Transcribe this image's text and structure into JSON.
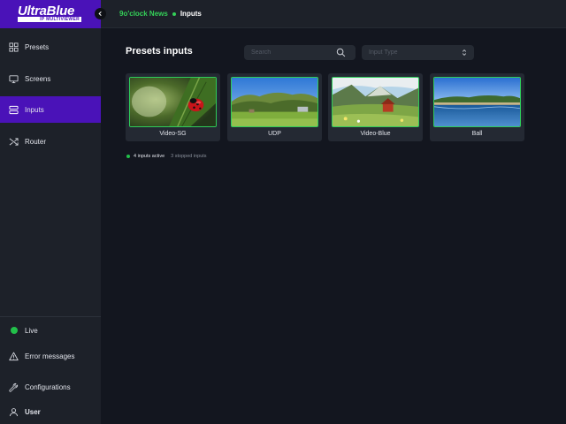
{
  "app": {
    "logo_title": "UltraBlue",
    "logo_subtitle": "IP MULTIVIEWER"
  },
  "sidebar": {
    "items": [
      {
        "label": "Presets",
        "icon": "grid-icon"
      },
      {
        "label": "Screens",
        "icon": "monitor-icon"
      },
      {
        "label": "Inputs",
        "icon": "inputs-icon",
        "active": true
      },
      {
        "label": "Router",
        "icon": "shuffle-icon"
      }
    ],
    "bottom": {
      "live_label": "Live",
      "errors_label": "Error messages",
      "config_label": "Configurations",
      "user_label": "User"
    }
  },
  "breadcrumb": {
    "parent": "9o'clock News",
    "current": "Inputs"
  },
  "main": {
    "title": "Presets inputs",
    "search_placeholder": "Search",
    "input_type_placeholder": "Input Type",
    "inputs": [
      {
        "name": "Video-SG",
        "thumb": "ladybug"
      },
      {
        "name": "UDP",
        "thumb": "meadow"
      },
      {
        "name": "Video-Blue",
        "thumb": "barn"
      },
      {
        "name": "Ball",
        "thumb": "lake"
      }
    ],
    "status": {
      "active": "4 inputs active",
      "stopped": "3 stopped inputs"
    }
  },
  "colors": {
    "accent_purple": "#4a12b8",
    "active_green": "#2ecc5a",
    "sidebar_bg": "#1d2129",
    "page_bg": "#13161f"
  }
}
